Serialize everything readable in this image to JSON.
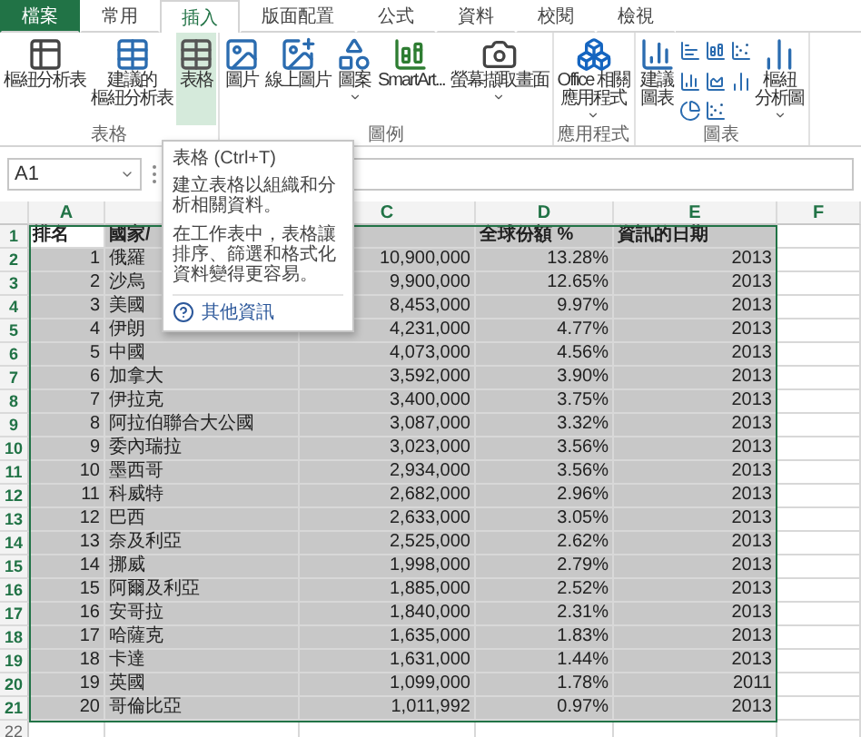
{
  "ribbon_tabs": [
    {
      "label": "檔案",
      "kind": "file",
      "selected": false
    },
    {
      "label": "常用",
      "kind": "tab",
      "selected": false
    },
    {
      "label": "插入",
      "kind": "tab",
      "selected": true
    },
    {
      "label": "版面配置",
      "kind": "tab",
      "selected": false
    },
    {
      "label": "公式",
      "kind": "tab",
      "selected": false
    },
    {
      "label": "資料",
      "kind": "tab",
      "selected": false
    },
    {
      "label": "校閱",
      "kind": "tab",
      "selected": false
    },
    {
      "label": "檢視",
      "kind": "tab",
      "selected": false
    }
  ],
  "ribbon_groups": [
    {
      "label": "表格",
      "buttons": [
        {
          "kind": "pivot",
          "label": [
            "樞紐分析表"
          ]
        },
        {
          "kind": "recpivot",
          "label": [
            "建議的",
            "樞紐分析表"
          ]
        },
        {
          "kind": "table",
          "label": [
            "表格"
          ],
          "hovered": true
        }
      ]
    },
    {
      "label": "圖例",
      "buttons": [
        {
          "kind": "picture",
          "label": [
            "圖片"
          ]
        },
        {
          "kind": "online",
          "label": [
            "線上圖片"
          ]
        },
        {
          "kind": "shapes",
          "label": [
            "圖案"
          ],
          "dropdown": true
        },
        {
          "kind": "smartart",
          "label": [
            "SmartArt..."
          ]
        },
        {
          "kind": "screenshot",
          "label": [
            "螢幕擷取畫面"
          ],
          "dropdown": true
        }
      ]
    },
    {
      "label": "應用程式",
      "buttons": [
        {
          "kind": "office",
          "label": [
            "Office 相關",
            "應用程式"
          ],
          "dropdown": true
        }
      ]
    },
    {
      "label": "圖表",
      "buttons": [
        {
          "kind": "recchart",
          "label": [
            "建議",
            "圖表"
          ]
        },
        {
          "kind": "minicharts"
        },
        {
          "kind": "pivotchart",
          "label": [
            "樞紐",
            "分析圖"
          ],
          "dropdown": true
        }
      ]
    }
  ],
  "name_box": "A1",
  "column_headers": [
    "A",
    "C",
    "D",
    "E",
    "F"
  ],
  "tooltip": {
    "title": "表格 (Ctrl+T)",
    "paragraphs": [
      "建立表格以組織和分析相關資料。",
      "在工作表中，表格讓排序、篩選和格式化資料變得更容易。"
    ],
    "link": "其他資訊"
  },
  "rows": [
    {
      "num": "1",
      "selected": true,
      "a": "排名",
      "b": "國家/",
      "d": "全球份額 %",
      "e": "資訊的日期"
    },
    {
      "num": "2",
      "selected": true,
      "a": "1",
      "b": "俄羅",
      "c": "10,900,000",
      "d": "13.28%",
      "e": "2013"
    },
    {
      "num": "3",
      "selected": true,
      "a": "2",
      "b": "沙烏",
      "c": "9,900,000",
      "d": "12.65%",
      "e": "2013"
    },
    {
      "num": "4",
      "selected": true,
      "a": "3",
      "b": "美國",
      "c": "8,453,000",
      "d": "9.97%",
      "e": "2013"
    },
    {
      "num": "5",
      "selected": true,
      "a": "4",
      "b": "伊朗",
      "c": "4,231,000",
      "d": "4.77%",
      "e": "2013"
    },
    {
      "num": "6",
      "selected": true,
      "a": "5",
      "b": "中國",
      "c": "4,073,000",
      "d": "4.56%",
      "e": "2013"
    },
    {
      "num": "7",
      "selected": true,
      "a": "6",
      "b": "加拿大",
      "c": "3,592,000",
      "d": "3.90%",
      "e": "2013"
    },
    {
      "num": "8",
      "selected": true,
      "a": "7",
      "b": "伊拉克",
      "c": "3,400,000",
      "d": "3.75%",
      "e": "2013"
    },
    {
      "num": "9",
      "selected": true,
      "a": "8",
      "b": "阿拉伯聯合大公國",
      "c": "3,087,000",
      "d": "3.32%",
      "e": "2013"
    },
    {
      "num": "10",
      "selected": true,
      "a": "9",
      "b": "委內瑞拉",
      "c": "3,023,000",
      "d": "3.56%",
      "e": "2013"
    },
    {
      "num": "11",
      "selected": true,
      "a": "10",
      "b": "墨西哥",
      "c": "2,934,000",
      "d": "3.56%",
      "e": "2013"
    },
    {
      "num": "12",
      "selected": true,
      "a": "11",
      "b": "科威特",
      "c": "2,682,000",
      "d": "2.96%",
      "e": "2013"
    },
    {
      "num": "13",
      "selected": true,
      "a": "12",
      "b": "巴西",
      "c": "2,633,000",
      "d": "3.05%",
      "e": "2013"
    },
    {
      "num": "14",
      "selected": true,
      "a": "13",
      "b": "奈及利亞",
      "c": "2,525,000",
      "d": "2.62%",
      "e": "2013"
    },
    {
      "num": "15",
      "selected": true,
      "a": "14",
      "b": "挪威",
      "c": "1,998,000",
      "d": "2.79%",
      "e": "2013"
    },
    {
      "num": "16",
      "selected": true,
      "a": "15",
      "b": "阿爾及利亞",
      "c": "1,885,000",
      "d": "2.52%",
      "e": "2013"
    },
    {
      "num": "17",
      "selected": true,
      "a": "16",
      "b": "安哥拉",
      "c": "1,840,000",
      "d": "2.31%",
      "e": "2013"
    },
    {
      "num": "18",
      "selected": true,
      "a": "17",
      "b": "哈薩克",
      "c": "1,635,000",
      "d": "1.83%",
      "e": "2013"
    },
    {
      "num": "19",
      "selected": true,
      "a": "18",
      "b": "卡達",
      "c": "1,631,000",
      "d": "1.44%",
      "e": "2013"
    },
    {
      "num": "20",
      "selected": true,
      "a": "19",
      "b": "英國",
      "c": "1,099,000",
      "d": "1.78%",
      "e": "2011"
    },
    {
      "num": "21",
      "selected": true,
      "a": "20",
      "b": "哥倫比亞",
      "c": "1,011,992",
      "d": "0.97%",
      "e": "2013"
    },
    {
      "num": "22",
      "selected": false
    }
  ]
}
